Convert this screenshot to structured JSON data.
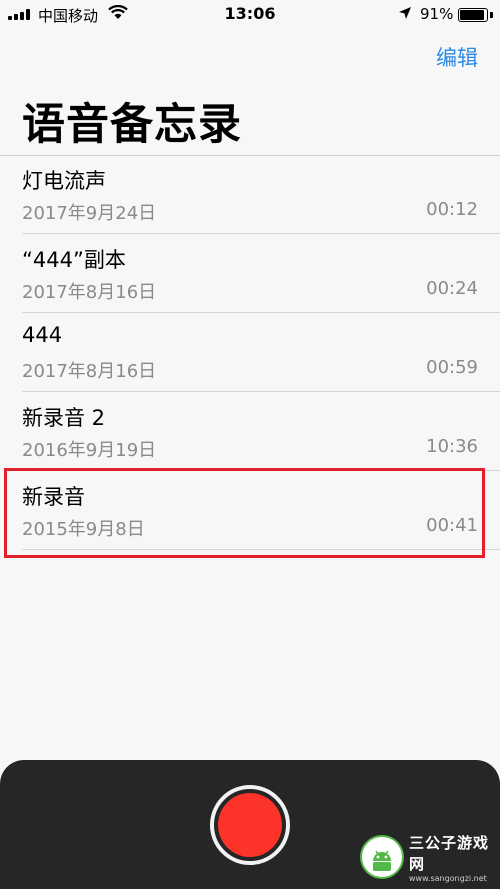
{
  "status_bar": {
    "carrier": "中国移动",
    "time": "13:06",
    "battery": "91%",
    "battery_level": 0.91
  },
  "header": {
    "edit_label": "编辑",
    "title": "语音备忘录"
  },
  "recordings": [
    {
      "title": "灯电流声",
      "date": "2017年9月24日",
      "duration": "00:12"
    },
    {
      "title": "“444”副本",
      "date": "2017年8月16日",
      "duration": "00:24"
    },
    {
      "title": "444",
      "date": "2017年8月16日",
      "duration": "00:59"
    },
    {
      "title": "新录音 2",
      "date": "2016年9月19日",
      "duration": "10:36"
    },
    {
      "title": "新录音",
      "date": "2015年9月8日",
      "duration": "00:41"
    }
  ],
  "watermark": {
    "title": "三公子游戏网",
    "url": "www.sangongzi.net"
  },
  "colors": {
    "accent": "#2a8ae6",
    "record": "#fb3329",
    "highlight": "#e3202c",
    "panel": "#262626"
  },
  "icons": [
    "signal-icon",
    "wifi-icon",
    "location-arrow-icon",
    "battery-icon",
    "record-icon"
  ]
}
